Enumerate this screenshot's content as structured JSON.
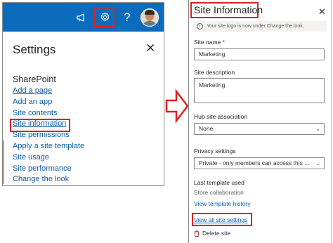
{
  "left_panel": {
    "title": "Settings",
    "section_heading": "SharePoint",
    "items": [
      {
        "label": "Add a page"
      },
      {
        "label": "Add an app"
      },
      {
        "label": "Site contents"
      },
      {
        "label": "Site information"
      },
      {
        "label": "Site permissions"
      },
      {
        "label": "Apply a site template"
      },
      {
        "label": "Site usage"
      },
      {
        "label": "Site performance"
      },
      {
        "label": "Change the look"
      }
    ],
    "help_glyph": "?",
    "topbar_color": "#0b6cbd",
    "icons": [
      "megaphone-icon",
      "gear-icon",
      "help-icon",
      "avatar",
      "close-icon"
    ]
  },
  "right_panel": {
    "title": "Site Information",
    "info_message": "Your site logo is now under Change the look.",
    "site_name": {
      "label": "Site name",
      "required_mark": "*",
      "value": "Marketing"
    },
    "site_description": {
      "label": "Site description",
      "value": "Marketing"
    },
    "hub_site_association": {
      "label": "Hub site association",
      "value": "None"
    },
    "privacy_settings": {
      "label": "Privacy settings",
      "value": "Private - only members can access this ..."
    },
    "last_template": {
      "label": "Last template used",
      "value": "Store collaboration"
    },
    "view_template_history": "View template history",
    "view_all_site_settings": "View all site settings",
    "delete_site": "Delete site"
  },
  "colors": {
    "highlight": "#e02020",
    "link": "#0b5cab",
    "arrow": "#e02020"
  }
}
